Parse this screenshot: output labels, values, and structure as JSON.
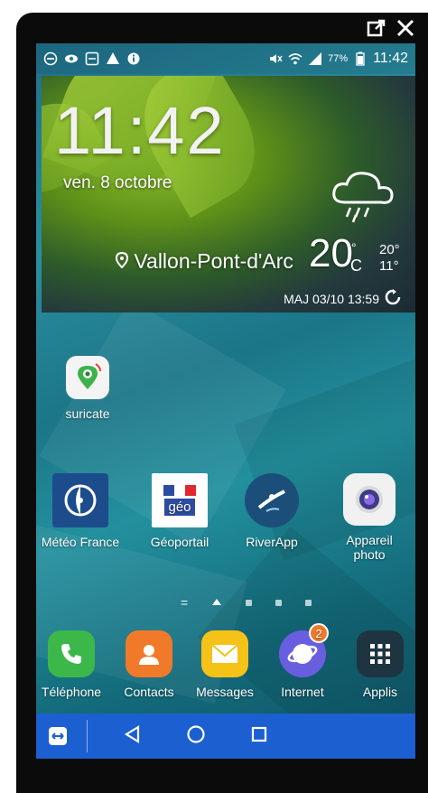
{
  "status_bar": {
    "battery": "77%",
    "time": "11:42"
  },
  "weather_widget": {
    "time": "11:42",
    "date": "ven. 8 octobre",
    "location": "Vallon-Pont-d'Arc",
    "temperature": "20",
    "degree_symbol": "°",
    "unit": "C",
    "high": "20°",
    "low": "11°",
    "updated": "MAJ 03/10 13:59"
  },
  "apps": [
    {
      "label": "suricate",
      "icon": "suricate-app-icon"
    },
    {
      "label": "Météo France",
      "icon": "meteo-france-icon"
    },
    {
      "label": "Géoportail",
      "icon": "geoportail-icon",
      "icon_text": "géo"
    },
    {
      "label": "RiverApp",
      "icon": "riverapp-icon"
    },
    {
      "label": "Appareil photo",
      "icon": "camera-icon"
    }
  ],
  "dock": [
    {
      "label": "Téléphone",
      "icon": "phone-icon",
      "color": "#3cb84a"
    },
    {
      "label": "Contacts",
      "icon": "contacts-icon",
      "color": "#f07a2a"
    },
    {
      "label": "Messages",
      "icon": "messages-icon",
      "color": "#f5c218"
    },
    {
      "label": "Internet",
      "icon": "internet-icon",
      "color": "#6a5ee0",
      "badge": "2"
    },
    {
      "label": "Applis",
      "icon": "apps-grid-icon",
      "color": "#1e3440"
    }
  ],
  "page_indicator": {
    "pages": 5,
    "active": 2
  },
  "colors": {
    "navbar": "#1c5fd1",
    "accent": "#f07a2a"
  }
}
